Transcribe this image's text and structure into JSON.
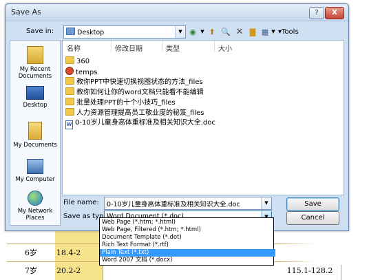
{
  "window": {
    "title": "Save As",
    "help": "?",
    "close": "X"
  },
  "savein": {
    "label": "Save in:",
    "value": "Desktop",
    "tools_label": "Tools"
  },
  "places": [
    {
      "label": "My Recent Documents",
      "icon": "recent-documents-icon"
    },
    {
      "label": "Desktop",
      "icon": "desktop-icon"
    },
    {
      "label": "My Documents",
      "icon": "my-documents-icon"
    },
    {
      "label": "My Computer",
      "icon": "my-computer-icon"
    },
    {
      "label": "My Network Places",
      "icon": "network-places-icon"
    }
  ],
  "columns": [
    "名称",
    "修改日期",
    "类型",
    "大小"
  ],
  "files": [
    {
      "name": "360",
      "kind": "folder"
    },
    {
      "name": "temps",
      "kind": "special"
    },
    {
      "name": "教你PPT中快速切换视图状态的方法_files",
      "kind": "folder"
    },
    {
      "name": "教你如何让你的word文档只能看不能编辑",
      "kind": "folder"
    },
    {
      "name": "批量处理PPT的十个小技巧_files",
      "kind": "folder"
    },
    {
      "name": "人力资源管理提高员工敬业度的秘笈_files",
      "kind": "folder"
    },
    {
      "name": "0-10岁儿童身高体重标准及相关知识大全.doc",
      "kind": "doc"
    }
  ],
  "filename": {
    "label": "File name:",
    "value": "0-10岁儿童身高体重标准及相关知识大全.doc"
  },
  "saveastype": {
    "label": "Save as type:",
    "value": "Word Document (*.doc)",
    "options": [
      "Web Page (*.htm; *.html)",
      "Web Page, Filtered (*.htm; *.html)",
      "Document Template (*.dot)",
      "Rich Text Format (*.rtf)",
      "Plain Text (*.txt)",
      "Word 2007 文档 (*.docx)"
    ],
    "highlighted_index": 4
  },
  "buttons": {
    "save": "Save",
    "cancel": "Cancel"
  },
  "background_table": {
    "rows": [
      {
        "age": "6岁",
        "col2": "18.4-2",
        "right": ""
      },
      {
        "age": "7岁",
        "col2": "20.2-2",
        "right": "115.1-128.2"
      }
    ]
  },
  "colors": {
    "accent": "#3399ff",
    "dialog_bg": "#cfe0f3",
    "table_highlight": "#f7e38c"
  }
}
